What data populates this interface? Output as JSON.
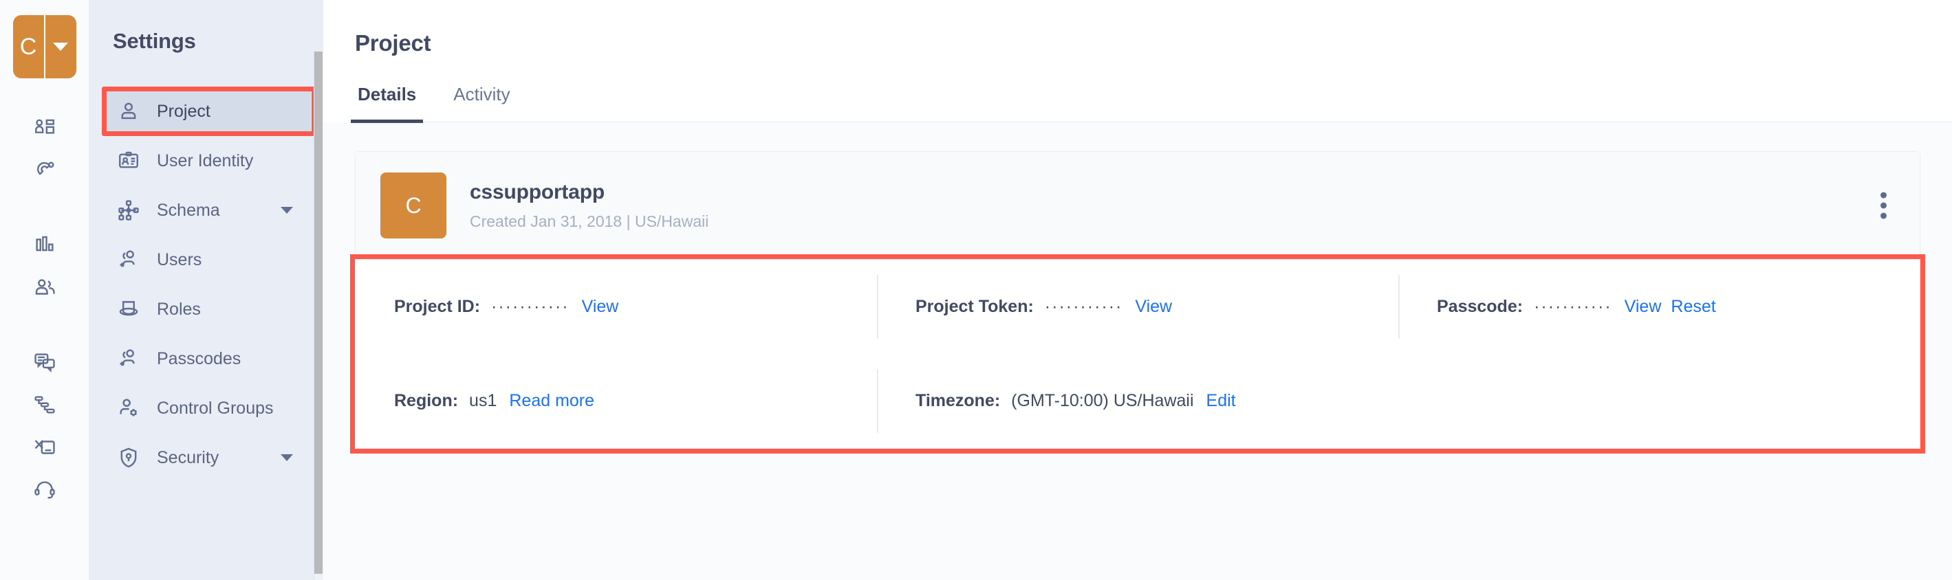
{
  "rail": {
    "logo": {
      "initial": "C",
      "name": "cssupportapp",
      "caret": "chevron-down-icon"
    },
    "items": [
      {
        "name": "dashboard-icon"
      },
      {
        "name": "magnet-icon"
      },
      {
        "name": "reports-icon"
      },
      {
        "name": "audience-icon"
      },
      {
        "name": "messages-icon"
      },
      {
        "name": "journeys-icon"
      },
      {
        "name": "campaigns-icon"
      },
      {
        "name": "support-icon"
      }
    ]
  },
  "sidebar": {
    "title": "Settings",
    "items": [
      {
        "label": "Project",
        "icon": "user-icon",
        "active": true,
        "caret": false
      },
      {
        "label": "User Identity",
        "icon": "id-card-icon",
        "active": false,
        "caret": false
      },
      {
        "label": "Schema",
        "icon": "schema-icon",
        "active": false,
        "caret": true
      },
      {
        "label": "Users",
        "icon": "users-add-icon",
        "active": false,
        "caret": false
      },
      {
        "label": "Roles",
        "icon": "hat-icon",
        "active": false,
        "caret": false
      },
      {
        "label": "Passcodes",
        "icon": "users-add-icon",
        "active": false,
        "caret": false
      },
      {
        "label": "Control Groups",
        "icon": "user-gear-icon",
        "active": false,
        "caret": false
      },
      {
        "label": "Security",
        "icon": "shield-lock-icon",
        "active": false,
        "caret": true
      }
    ]
  },
  "main": {
    "page_title": "Project",
    "tabs": [
      {
        "label": "Details",
        "active": true
      },
      {
        "label": "Activity",
        "active": false
      }
    ],
    "card": {
      "avatar_initial": "C",
      "project_name": "cssupportapp",
      "meta": "Created Jan 31, 2018 | US/Hawaii",
      "menu_icon": "kebab-menu-icon"
    },
    "details": {
      "project_id": {
        "label": "Project ID:",
        "masked_value": "···········",
        "view_label": "View"
      },
      "project_token": {
        "label": "Project Token:",
        "masked_value": "···········",
        "view_label": "View"
      },
      "passcode": {
        "label": "Passcode:",
        "masked_value": "···········",
        "view_label": "View",
        "reset_label": "Reset"
      },
      "region": {
        "label": "Region:",
        "value": "us1",
        "link_label": "Read more"
      },
      "timezone": {
        "label": "Timezone:",
        "value": "(GMT-10:00) US/Hawaii",
        "link_label": "Edit"
      }
    }
  },
  "colors": {
    "brand_orange": "#d4893b",
    "highlight_red": "#fa5a4b",
    "link_blue": "#1a73f0",
    "sidebar_bg": "#e8edf6",
    "text_dark": "#414963"
  }
}
